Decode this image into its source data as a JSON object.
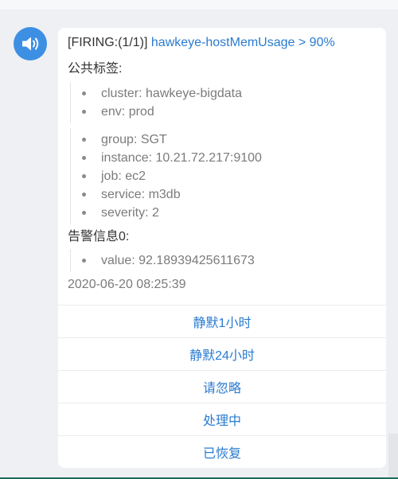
{
  "alert": {
    "status_prefix": "[FIRING:(1/1)]",
    "title_link": "hawkeye-hostMemUsage > 90%",
    "common_labels_heading": "公共标签:",
    "common_labels": [
      "cluster: hawkeye-bigdata",
      "env: prod"
    ],
    "labels": [
      "group: SGT",
      "instance: 10.21.72.217:9100",
      "job: ec2",
      "service: m3db",
      "severity: 2"
    ],
    "alert_info_heading": "告警信息0:",
    "alert_info": [
      "value: 92.18939425611673"
    ],
    "timestamp": "2020-06-20 08:25:39"
  },
  "actions": {
    "silence_1h": "静默1小时",
    "silence_24h": "静默24小时",
    "ignore": "请忽略",
    "processing": "处理中",
    "recovered": "已恢复"
  },
  "colors": {
    "avatar": "#3d8fe3",
    "link": "#2a7bd0",
    "muted_text": "#7b7b7b"
  },
  "icons": {
    "avatar": "speaker-icon"
  }
}
